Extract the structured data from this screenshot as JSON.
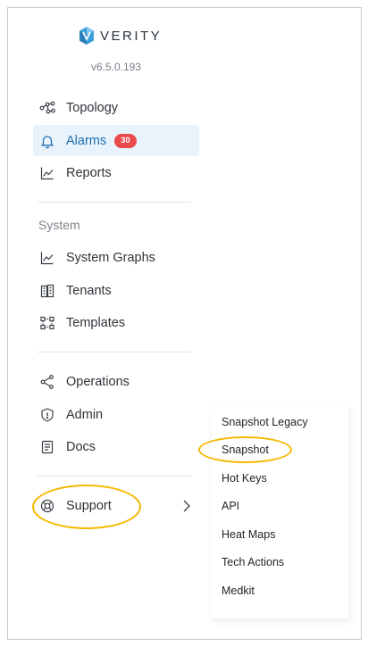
{
  "brand": {
    "name": "VERITY",
    "version": "v6.5.0.193",
    "accent_color": "#1e6fb0",
    "logo_color": "#3a9fd8"
  },
  "nav": {
    "topology": {
      "label": "Topology",
      "icon": "topology-icon"
    },
    "alarms": {
      "label": "Alarms",
      "icon": "bell-icon",
      "badge": "30",
      "active": true
    },
    "reports": {
      "label": "Reports",
      "icon": "chart-icon"
    },
    "system_section": "System",
    "system_graphs": {
      "label": "System Graphs",
      "icon": "chart-icon"
    },
    "tenants": {
      "label": "Tenants",
      "icon": "building-icon"
    },
    "templates": {
      "label": "Templates",
      "icon": "templates-icon"
    },
    "operations": {
      "label": "Operations",
      "icon": "share-icon"
    },
    "admin": {
      "label": "Admin",
      "icon": "shield-icon"
    },
    "docs": {
      "label": "Docs",
      "icon": "document-icon"
    },
    "support": {
      "label": "Support",
      "icon": "lifebuoy-icon"
    }
  },
  "support_menu": {
    "items": [
      "Snapshot Legacy",
      "Snapshot",
      "Hot Keys",
      "API",
      "Heat Maps",
      "Tech Actions",
      "Medkit"
    ]
  },
  "colors": {
    "highlight": "#f5b800",
    "badge": "#e8494a",
    "active_bg": "#e8f3fb"
  }
}
